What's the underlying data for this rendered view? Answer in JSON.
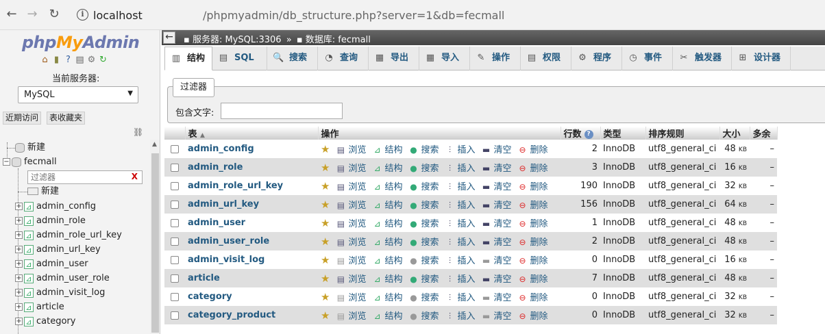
{
  "browser": {
    "url_host": "localhost",
    "url_path": "/phpmyadmin/db_structure.php?server=1&db=fecmall"
  },
  "nav": {
    "logo_php": "php",
    "logo_my": "My",
    "logo_admin": "Admin",
    "server_label": "当前服务器:",
    "server_value": "MySQL",
    "recent_label": "近期访问",
    "favorites_label": "表收藏夹",
    "tree": {
      "new_db": "新建",
      "db_name": "fecmall",
      "filter_placeholder": "过滤器",
      "filter_clear": "X",
      "new_table": "新建",
      "tables": [
        "admin_config",
        "admin_role",
        "admin_role_url_key",
        "admin_url_key",
        "admin_user",
        "admin_user_role",
        "admin_visit_log",
        "article",
        "category"
      ]
    }
  },
  "breadcrumb": {
    "server": "服务器: MySQL:3306",
    "sep": "»",
    "database": "数据库: fecmall"
  },
  "tabs": [
    {
      "label": "结构",
      "icon": "structure-icon"
    },
    {
      "label": "SQL",
      "icon": "sql-icon"
    },
    {
      "label": "搜索",
      "icon": "search-icon"
    },
    {
      "label": "查询",
      "icon": "query-icon"
    },
    {
      "label": "导出",
      "icon": "export-icon"
    },
    {
      "label": "导入",
      "icon": "import-icon"
    },
    {
      "label": "操作",
      "icon": "wrench-icon"
    },
    {
      "label": "权限",
      "icon": "privileges-icon"
    },
    {
      "label": "程序",
      "icon": "routines-icon"
    },
    {
      "label": "事件",
      "icon": "events-icon"
    },
    {
      "label": "触发器",
      "icon": "triggers-icon"
    },
    {
      "label": "设计器",
      "icon": "designer-icon"
    }
  ],
  "filter": {
    "legend": "过滤器",
    "label": "包含文字:",
    "value": ""
  },
  "table": {
    "headers": {
      "table": "表",
      "actions": "操作",
      "rows": "行数",
      "type": "类型",
      "collation": "排序规则",
      "size": "大小",
      "overhead": "多余"
    },
    "action_labels": {
      "browse": "浏览",
      "structure": "结构",
      "search": "搜索",
      "insert": "插入",
      "empty": "清空",
      "drop": "删除"
    },
    "rows": [
      {
        "name": "admin_config",
        "rows": "2",
        "type": "InnoDB",
        "collation": "utf8_general_ci",
        "size": "48",
        "unit": "KB",
        "overhead": "–"
      },
      {
        "name": "admin_role",
        "rows": "3",
        "type": "InnoDB",
        "collation": "utf8_general_ci",
        "size": "16",
        "unit": "KB",
        "overhead": "–"
      },
      {
        "name": "admin_role_url_key",
        "rows": "190",
        "type": "InnoDB",
        "collation": "utf8_general_ci",
        "size": "32",
        "unit": "KB",
        "overhead": "–"
      },
      {
        "name": "admin_url_key",
        "rows": "156",
        "type": "InnoDB",
        "collation": "utf8_general_ci",
        "size": "64",
        "unit": "KB",
        "overhead": "–"
      },
      {
        "name": "admin_user",
        "rows": "1",
        "type": "InnoDB",
        "collation": "utf8_general_ci",
        "size": "48",
        "unit": "KB",
        "overhead": "–"
      },
      {
        "name": "admin_user_role",
        "rows": "2",
        "type": "InnoDB",
        "collation": "utf8_general_ci",
        "size": "48",
        "unit": "KB",
        "overhead": "–"
      },
      {
        "name": "admin_visit_log",
        "rows": "0",
        "type": "InnoDB",
        "collation": "utf8_general_ci",
        "size": "16",
        "unit": "KB",
        "overhead": "–"
      },
      {
        "name": "article",
        "rows": "7",
        "type": "InnoDB",
        "collation": "utf8_general_ci",
        "size": "48",
        "unit": "KB",
        "overhead": "–"
      },
      {
        "name": "category",
        "rows": "0",
        "type": "InnoDB",
        "collation": "utf8_general_ci",
        "size": "32",
        "unit": "KB",
        "overhead": "–"
      },
      {
        "name": "category_product",
        "rows": "0",
        "type": "InnoDB",
        "collation": "utf8_general_ci",
        "size": "32",
        "unit": "KB",
        "overhead": "–"
      }
    ]
  }
}
